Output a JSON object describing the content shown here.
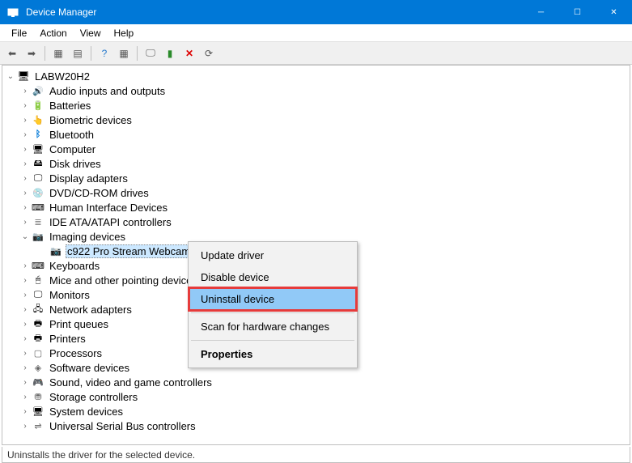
{
  "window": {
    "title": "Device Manager"
  },
  "menubar": [
    "File",
    "Action",
    "View",
    "Help"
  ],
  "tree": {
    "root": {
      "label": "LABW20H2",
      "icon": "ic-pc",
      "expanded": true
    },
    "categories": [
      {
        "label": "Audio inputs and outputs",
        "icon": "ic-audio",
        "expanded": false
      },
      {
        "label": "Batteries",
        "icon": "ic-batt",
        "expanded": false
      },
      {
        "label": "Biometric devices",
        "icon": "ic-bio",
        "expanded": false
      },
      {
        "label": "Bluetooth",
        "icon": "ic-bt",
        "expanded": false
      },
      {
        "label": "Computer",
        "icon": "ic-comp",
        "expanded": false
      },
      {
        "label": "Disk drives",
        "icon": "ic-disk",
        "expanded": false
      },
      {
        "label": "Display adapters",
        "icon": "ic-disp",
        "expanded": false
      },
      {
        "label": "DVD/CD-ROM drives",
        "icon": "ic-dvd",
        "expanded": false
      },
      {
        "label": "Human Interface Devices",
        "icon": "ic-hid",
        "expanded": false
      },
      {
        "label": "IDE ATA/ATAPI controllers",
        "icon": "ic-ide",
        "expanded": false
      },
      {
        "label": "Imaging devices",
        "icon": "ic-img",
        "expanded": true,
        "children": [
          {
            "label": "c922 Pro Stream Webcam",
            "icon": "ic-cam",
            "selected": true
          }
        ]
      },
      {
        "label": "Keyboards",
        "icon": "ic-kbd",
        "expanded": false
      },
      {
        "label": "Mice and other pointing devices",
        "icon": "ic-mouse",
        "expanded": false
      },
      {
        "label": "Monitors",
        "icon": "ic-mon",
        "expanded": false
      },
      {
        "label": "Network adapters",
        "icon": "ic-net",
        "expanded": false
      },
      {
        "label": "Print queues",
        "icon": "ic-printq",
        "expanded": false
      },
      {
        "label": "Printers",
        "icon": "ic-print",
        "expanded": false
      },
      {
        "label": "Processors",
        "icon": "ic-cpu",
        "expanded": false
      },
      {
        "label": "Software devices",
        "icon": "ic-sw",
        "expanded": false
      },
      {
        "label": "Sound, video and game controllers",
        "icon": "ic-snd",
        "expanded": false
      },
      {
        "label": "Storage controllers",
        "icon": "ic-stor",
        "expanded": false
      },
      {
        "label": "System devices",
        "icon": "ic-sys",
        "expanded": false
      },
      {
        "label": "Universal Serial Bus controllers",
        "icon": "ic-usb",
        "expanded": false
      }
    ]
  },
  "context_menu": {
    "items": [
      {
        "label": "Update driver",
        "type": "item"
      },
      {
        "label": "Disable device",
        "type": "item"
      },
      {
        "label": "Uninstall device",
        "type": "item",
        "hover": true,
        "highlight": true
      },
      {
        "type": "sep"
      },
      {
        "label": "Scan for hardware changes",
        "type": "item"
      },
      {
        "type": "sep"
      },
      {
        "label": "Properties",
        "type": "item",
        "bold": true
      }
    ]
  },
  "statusbar": {
    "text": "Uninstalls the driver for the selected device."
  }
}
